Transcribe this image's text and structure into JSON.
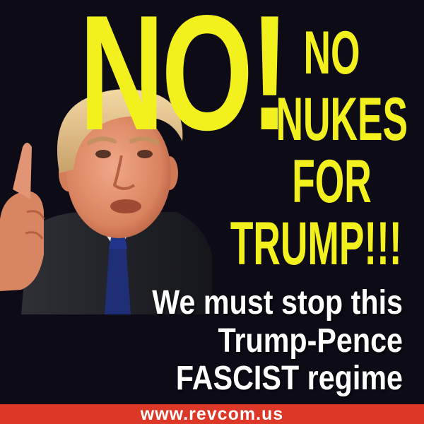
{
  "headline": {
    "big": "NO!"
  },
  "slogan": {
    "lines": [
      "NO",
      "NUKES",
      "FOR",
      "TRUMP!!!"
    ]
  },
  "call_to_action": {
    "lines": [
      "We must stop this",
      "Trump-Pence",
      "FASCIST regime"
    ]
  },
  "footer": {
    "url": "www.revcom.us"
  },
  "photo": {
    "subject": "portrait-photo"
  },
  "colors": {
    "background": "#0d0c16",
    "headline_yellow": "#f2f01d",
    "text_white": "#ffffff",
    "footer_red": "#dd3727"
  }
}
